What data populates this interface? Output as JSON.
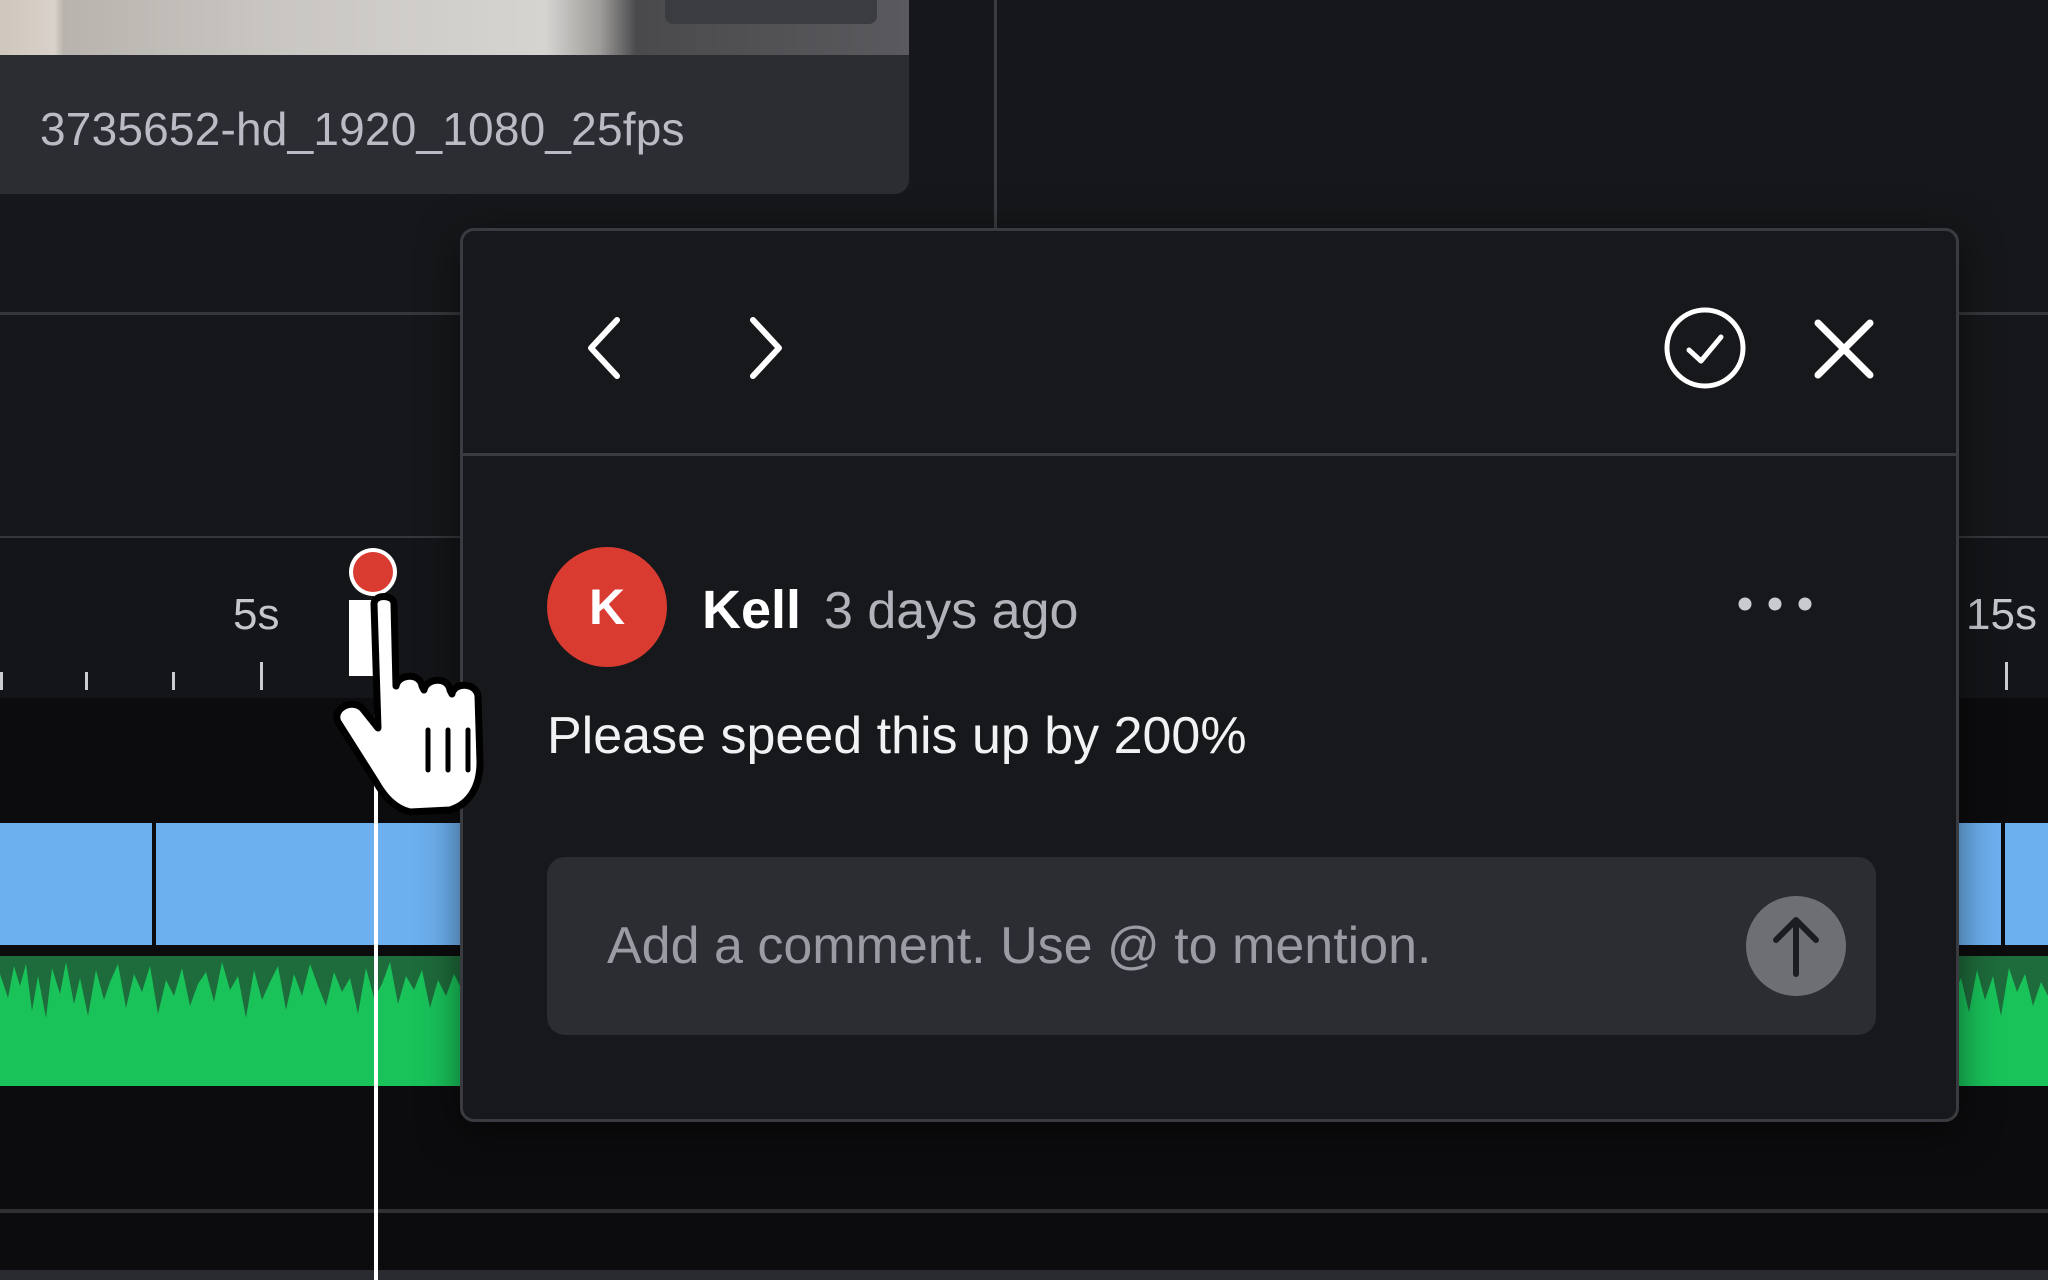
{
  "media": {
    "filename": "3735652-hd_1920_1080_25fps"
  },
  "ruler": {
    "labels": [
      "5s",
      "15s"
    ]
  },
  "comment_popup": {
    "nav_prev_icon": "chevron-left-icon",
    "nav_next_icon": "chevron-right-icon",
    "resolve_icon": "check-circle-icon",
    "close_icon": "close-icon",
    "comment": {
      "avatar_initial": "K",
      "author": "Kell",
      "timestamp": "3 days ago",
      "text": "Please speed this up by 200%",
      "more_icon": "more-horizontal-icon"
    },
    "reply": {
      "placeholder": "Add a comment. Use @ to mention.",
      "value": "",
      "send_icon": "arrow-up-icon"
    }
  },
  "colors": {
    "avatar": "#d93b30",
    "playhead_marker": "#d93b30",
    "video_track": "#6db0ef",
    "audio_track": "#19c35a"
  }
}
